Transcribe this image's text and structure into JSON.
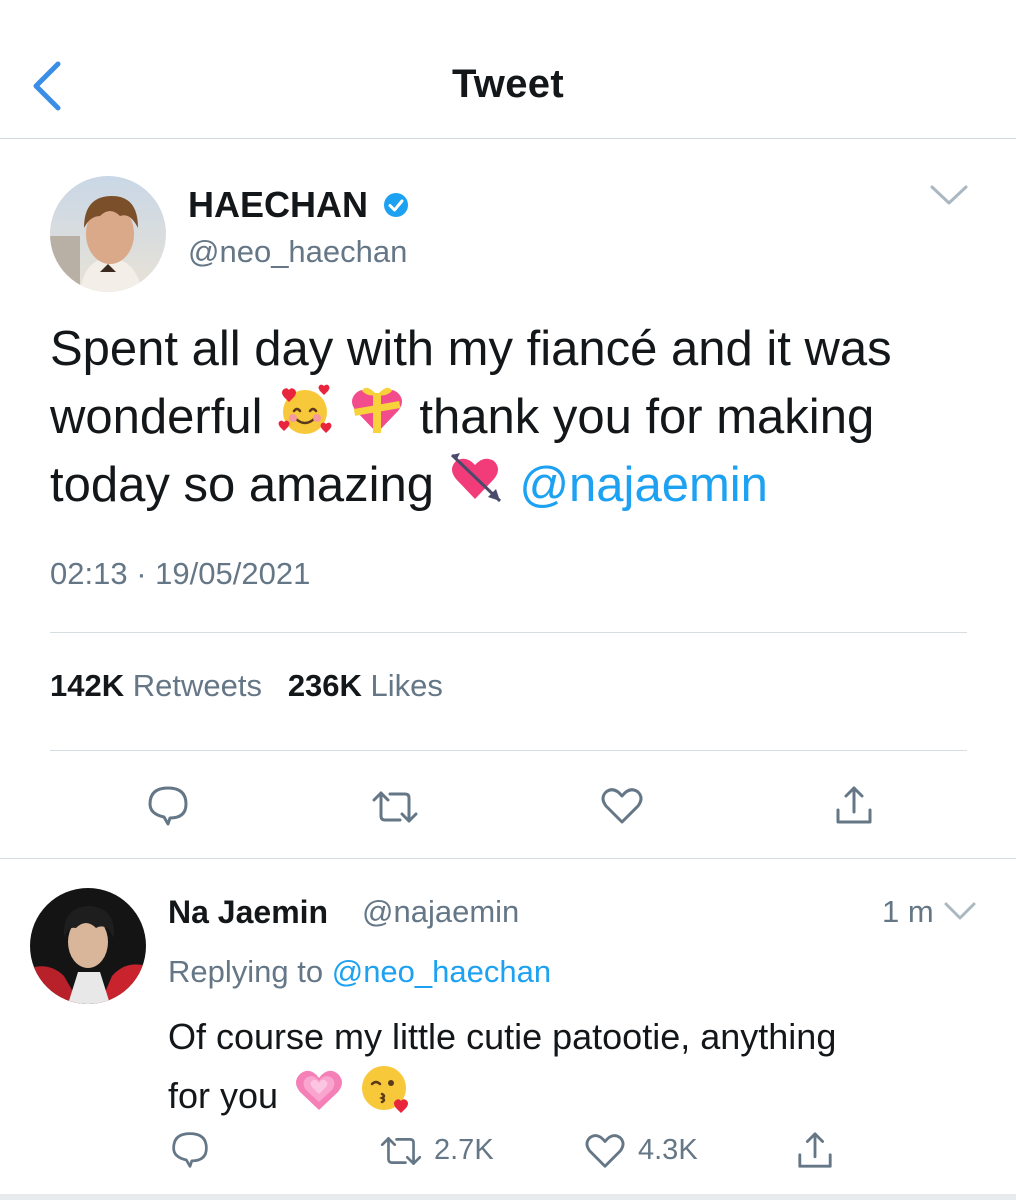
{
  "header": {
    "title": "Tweet"
  },
  "tweet": {
    "author_name": "HAECHAN",
    "author_handle": "@neo_haechan",
    "text_line1": "Spent all day with my fiancé and it was",
    "text_line2_a": "wonderful",
    "text_line2_b": "thank you for making",
    "text_line3_a": "today so amazing",
    "mention": "@najaemin",
    "emojis": [
      "smiling-face-with-hearts",
      "heart-with-ribbon",
      "heart-with-arrow"
    ],
    "time": "02:13",
    "separator": "·",
    "date": "19/05/2021",
    "retweet_count": "142K",
    "retweet_label": "Retweets",
    "like_count": "236K",
    "like_label": "Likes"
  },
  "reply": {
    "author_name": "Na Jaemin",
    "author_handle": "@najaemin",
    "time": "1 m",
    "replying_label": "Replying to",
    "replying_handle": "@neo_haechan",
    "text_line1": "Of course my little cutie patootie, anything",
    "text_line2": "for you",
    "emojis": [
      "growing-heart",
      "face-blowing-kiss"
    ],
    "retweet_count": "2.7K",
    "like_count": "4.3K"
  },
  "colors": {
    "accent": "#1da1f2",
    "back_arrow": "#3b8ee6",
    "secondary_text": "#657786",
    "verified": "#1da1f2"
  }
}
